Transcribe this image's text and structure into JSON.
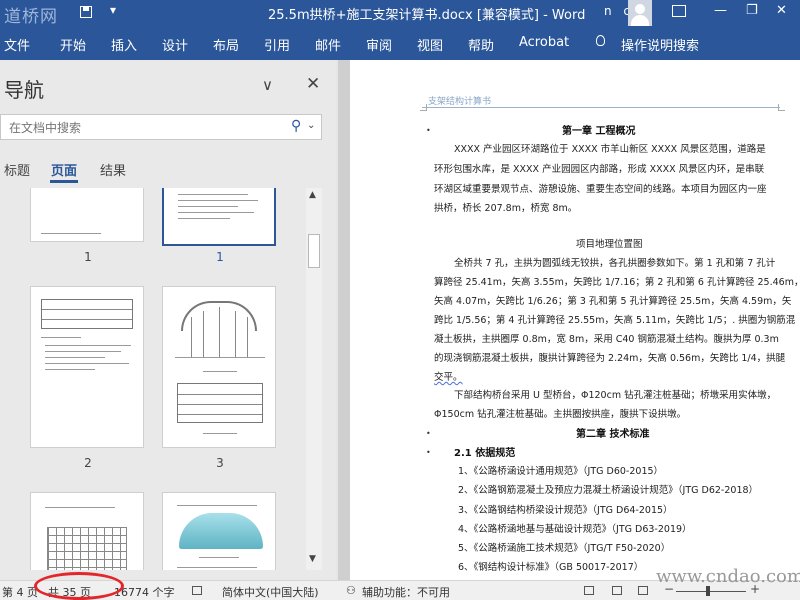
{
  "titlebar": {
    "logo_text": "道桥网",
    "title": "25.5m拱桥+施工支架计算书.docx [兼容模式] - Word",
    "user_initials": "n c",
    "minimize": "—",
    "restore": "❐",
    "close": "✕"
  },
  "ribbon": {
    "tabs": [
      "文件",
      "开始",
      "插入",
      "设计",
      "布局",
      "引用",
      "邮件",
      "审阅",
      "视图",
      "帮助",
      "Acrobat"
    ],
    "tell_me": "操作说明搜索"
  },
  "navigation": {
    "title": "导航",
    "search_placeholder": "在文档中搜索",
    "subtabs": [
      "标题",
      "页面",
      "结果"
    ],
    "active_subtab": "页面",
    "page_labels": [
      "1",
      "1",
      "2",
      "3"
    ]
  },
  "document": {
    "header": "支架结构计算书",
    "lines": [
      "第一章 工程概况",
      "XXXX 产业园区环湖路位于 XXXX 市羊山新区 XXXX 风景区范围，道路是",
      "环形包围水库，是 XXXX 产业园园区内部路，形成 XXXX 风景区内环，是串联",
      "环湖区域重要景观节点、游憩设施、重要生态空间的线路。本项目为园区内一座",
      "拱桥，桥长 207.8m，桥宽 8m。",
      "项目地理位置图",
      "全桥共 7 孔，主拱为圆弧线无铰拱，各孔拱圈参数如下。第 1 孔和第 7 孔计",
      "算跨径 25.41m，矢高 3.55m，矢跨比 1/7.16；第 2 孔和第 6 孔计算跨径 25.46m，",
      "矢高 4.07m，矢跨比 1/6.26；第 3 孔和第 5 孔计算跨径 25.5m，矢高 4.59m，矢",
      "跨比 1/5.56；第 4 孔计算跨径 25.55m，矢高 5.11m，矢跨比 1/5；. 拱圈为钢筋混",
      "凝土板拱，主拱圈厚 0.8m，宽 8m，采用 C40 钢筋混凝土结构。腹拱为厚 0.3m",
      "的现浇钢筋混凝土板拱，腹拱计算跨径为 2.24m，矢高 0.56m，矢跨比 1/4，拱腿",
      "交平。",
      "下部结构桥台采用 U 型桥台，Φ120cm 钻孔灌注桩基础；桥墩采用实体墩，",
      "Φ150cm 钻孔灌注桩基础。主拱圈按拱座，腹拱下设拱墩。",
      "第二章 技术标准",
      "2.1 依据规范",
      "1、《公路桥涵设计通用规范》（JTG D60-2015）",
      "2、《公路钢筋混凝土及预应力混凝土桥涵设计规范》（JTG D62-2018）",
      "3、《公路钢结构桥梁设计规范》（JTG D64-2015）",
      "4、《公路桥涵地基与基础设计规范》（JTG D63-2019）",
      "5、《公路桥涵施工技术规范》（JTG/T F50-2020）",
      "6、《钢结构设计标准》（GB 50017-2017）"
    ]
  },
  "statusbar": {
    "page": "第 4 页",
    "total": "共 35 页",
    "words": "16774 个字",
    "language": "简体中文(中国大陆)",
    "accessibility": "辅助功能：不可用"
  },
  "watermark": "www.cndao.com",
  "colors": {
    "word_blue": "#2b579a",
    "annotation_red": "#e3262b"
  }
}
